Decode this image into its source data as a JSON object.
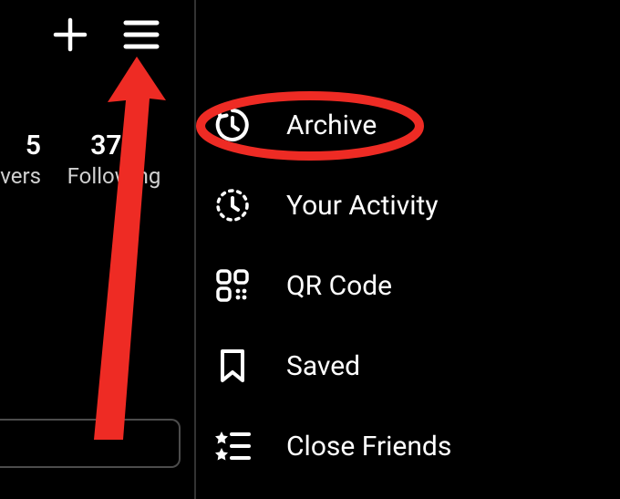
{
  "header": {
    "plus_icon": "plus",
    "menu_icon": "hamburger"
  },
  "stats": {
    "left_number": "5",
    "left_label": "vers",
    "right_number": "374",
    "right_label": "Following"
  },
  "menu": {
    "items": [
      {
        "icon": "archive",
        "label": "Archive"
      },
      {
        "icon": "activity",
        "label": "Your Activity"
      },
      {
        "icon": "qrcode",
        "label": "QR Code"
      },
      {
        "icon": "saved",
        "label": "Saved"
      },
      {
        "icon": "close-friends",
        "label": "Close Friends"
      }
    ]
  },
  "annotation": {
    "arrow_color": "#ee2b24",
    "circle_color": "#ee2b24"
  }
}
